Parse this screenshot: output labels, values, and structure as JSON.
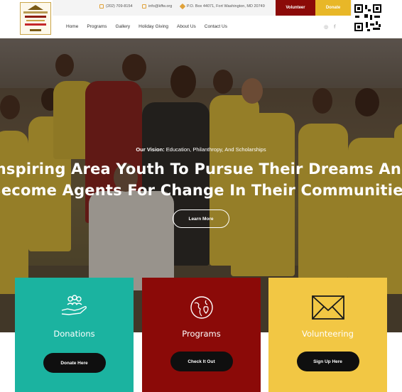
{
  "header": {
    "phone": "(202) 709-8154",
    "email": "info@kffw.org",
    "address": "P.O. Box 44071, Fort Washington, MD 20749",
    "volunteer_label": "Volunteer",
    "donate_label": "Donate",
    "nav": [
      "Home",
      "Programs",
      "Gallery",
      "Holiday Giving",
      "About Us",
      "Contact Us"
    ],
    "social": [
      "instagram-icon",
      "facebook-icon"
    ]
  },
  "hero": {
    "vision_label": "Our Vision:",
    "vision_text": "Education, Philanthropy, And Scholarships",
    "headline_line1": "Inspiring Area Youth To Pursue Their Dreams And",
    "headline_line2": "Become Agents For Change In Their Communities",
    "cta_label": "Learn More"
  },
  "cards": [
    {
      "title": "Donations",
      "button": "Donate Here",
      "icon": "hands-people-icon",
      "color": "#1bb3a0"
    },
    {
      "title": "Programs",
      "button": "Check It Out",
      "icon": "globe-heart-icon",
      "color": "#8b0a08"
    },
    {
      "title": "Volunteering",
      "button": "Sign Up Here",
      "icon": "envelope-icon",
      "color": "#f2c744"
    }
  ],
  "colors": {
    "accent_red": "#8b0a08",
    "accent_gold": "#e8b728",
    "teal": "#1bb3a0",
    "yellow": "#f2c744"
  }
}
